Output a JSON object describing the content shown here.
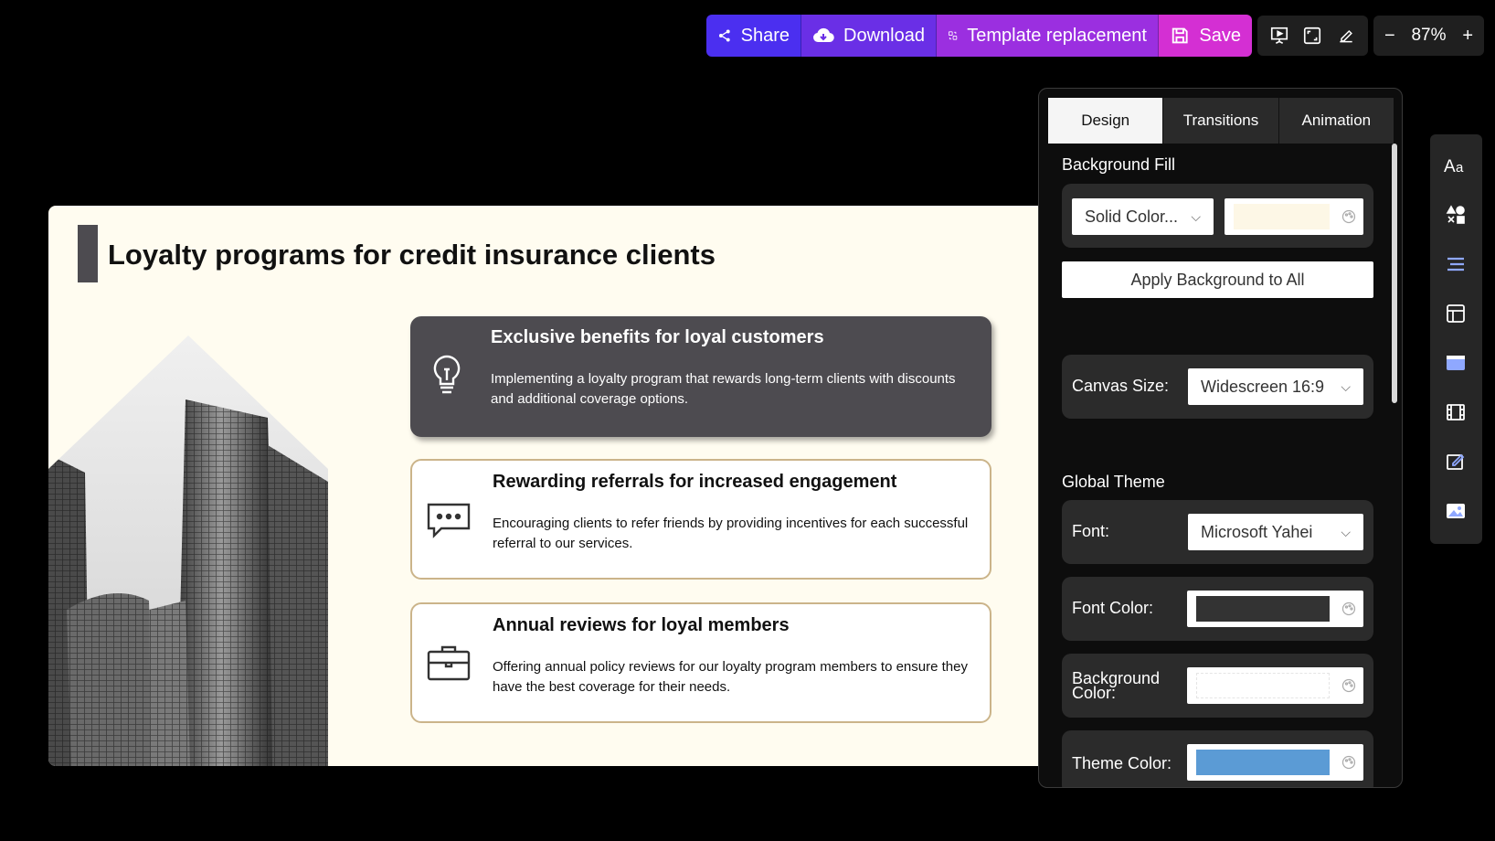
{
  "toolbar": {
    "share_label": "Share",
    "download_label": "Download",
    "template_label": "Template replacement",
    "save_label": "Save",
    "zoom_out": "−",
    "zoom_level": "87%",
    "zoom_in": "+"
  },
  "slide": {
    "title": "Loyalty programs for credit insurance clients",
    "background": "#fffcf0",
    "cards": [
      {
        "title": "Exclusive benefits for loyal customers",
        "text": "Implementing a loyalty program that rewards long-term clients with discounts and additional coverage options.",
        "icon": "lightbulb-icon"
      },
      {
        "title": "Rewarding referrals for increased engagement",
        "text": "Encouraging clients to refer friends by providing incentives for each successful referral to our services.",
        "icon": "chat-bubble-icon"
      },
      {
        "title": "Annual reviews for loyal members",
        "text": "Offering annual policy reviews for our loyalty program members to ensure they have the best coverage for their needs.",
        "icon": "briefcase-icon"
      }
    ]
  },
  "panel": {
    "tabs": [
      "Design",
      "Transitions",
      "Animation"
    ],
    "active_tab": "Design",
    "background_fill_label": "Background Fill",
    "fill_type": "Solid Color...",
    "fill_color": "#fdf7e6",
    "apply_background_label": "Apply Background to All",
    "canvas_size_label": "Canvas Size:",
    "canvas_size_value": "Widescreen 16:9",
    "global_theme_label": "Global Theme",
    "font_label": "Font:",
    "font_value": "Microsoft Yahei",
    "font_color_label": "Font Color:",
    "font_color": "#333333",
    "background_color_label": "Background Color:",
    "background_color": "#ffffff",
    "theme_color_label": "Theme Color:",
    "theme_color": "#5b9bd5"
  },
  "rail": {
    "items": [
      "text-style-icon",
      "shapes-icon",
      "align-icon",
      "layout-icon",
      "card-icon",
      "film-icon",
      "edit-icon",
      "image-icon"
    ]
  },
  "colors": {
    "share": "#4b2ff0",
    "download": "#6a2fe6",
    "template": "#9b2fe0",
    "save": "#d42fd3",
    "card_dark": "#4d4b50",
    "card_border": "#cbb48a"
  }
}
